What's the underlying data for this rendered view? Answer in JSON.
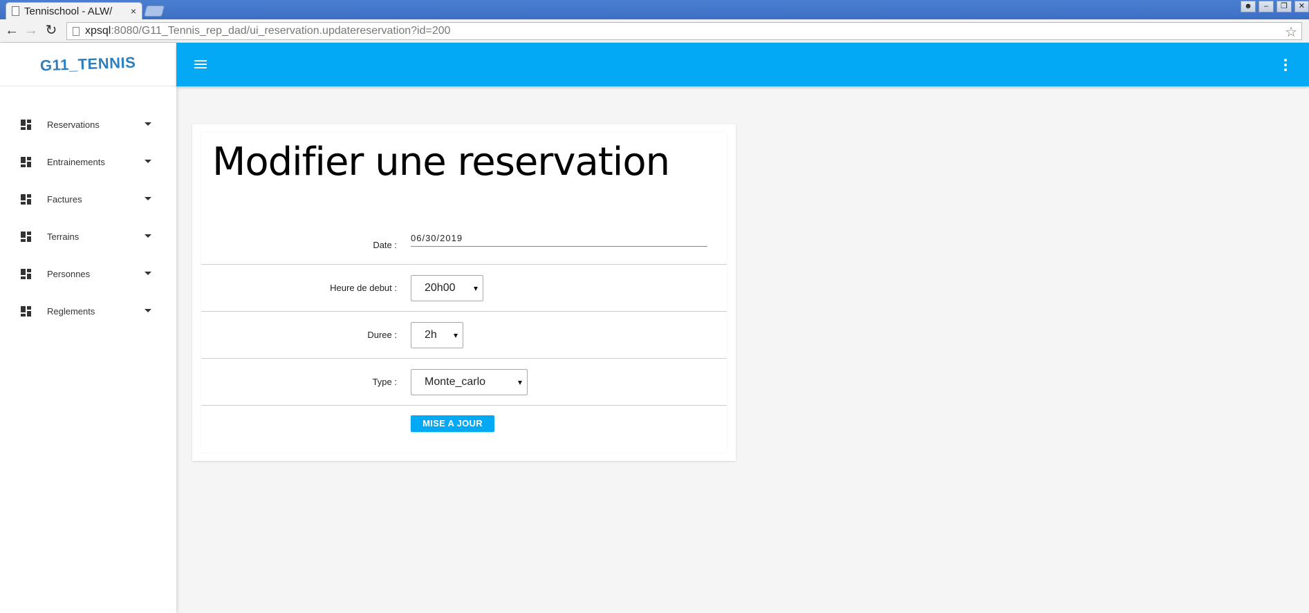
{
  "browser": {
    "tab_title": "Tennischool - ALW/",
    "tab_close": "×",
    "url_host": "xpsql",
    "url_rest": ":8080/G11_Tennis_rep_dad/ui_reservation.updatereservation?id=200"
  },
  "sidebar": {
    "logo": "G11_TENNIS",
    "items": [
      {
        "label": "Reservations",
        "icon": "dashboard-icon"
      },
      {
        "label": "Entrainements",
        "icon": "dashboard-icon"
      },
      {
        "label": "Factures",
        "icon": "dashboard-icon"
      },
      {
        "label": "Terrains",
        "icon": "dashboard-icon"
      },
      {
        "label": "Personnes",
        "icon": "dashboard-icon"
      },
      {
        "label": "Reglements",
        "icon": "dashboard-icon"
      }
    ]
  },
  "appbar": {
    "color": "#03a9f4",
    "menu_icon": "hamburger-icon",
    "more_icon": "more-vert-icon"
  },
  "form": {
    "title": "Modifier une reservation",
    "date_label": "Date :",
    "date_value": "06/30/2019",
    "start_label": "Heure de debut :",
    "start_value": "20h00",
    "duration_label": "Duree :",
    "duration_value": "2h",
    "type_label": "Type :",
    "type_value": "Monte_carlo",
    "submit_label": "MISE A JOUR"
  }
}
